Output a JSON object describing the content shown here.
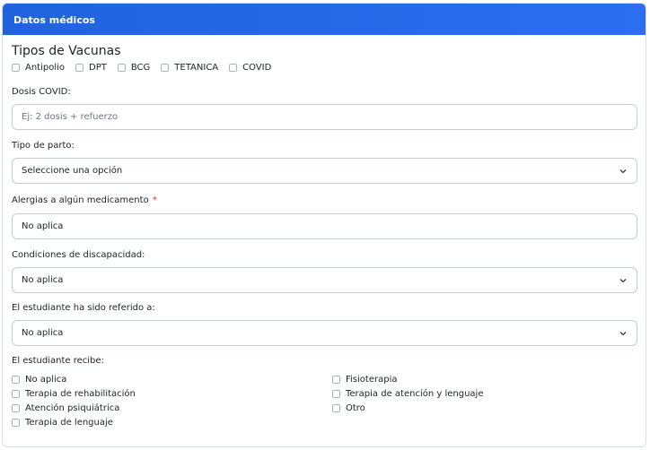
{
  "header": {
    "title": "Datos médicos"
  },
  "vaccines": {
    "title": "Tipos de Vacunas",
    "options": [
      "Antipolio",
      "DPT",
      "BCG",
      "TETANICA",
      "COVID"
    ]
  },
  "covid_doses": {
    "label": "Dosis COVID:",
    "placeholder": "Ej: 2 dosis + refuerzo"
  },
  "birth_type": {
    "label": "Tipo de parto:",
    "value": "Seleccione una opción"
  },
  "allergies": {
    "label": "Alergias a algún medicamento",
    "required_mark": "*",
    "value": "No aplica"
  },
  "disability": {
    "label": "Condiciones de discapacidad:",
    "value": "No aplica"
  },
  "referred": {
    "label": "El estudiante ha sido referido a:",
    "value": "No aplica"
  },
  "receives": {
    "label": "El estudiante recibe:",
    "left": [
      "No aplica",
      "Terapia de rehabilitación",
      "Atención psiquiátrica",
      "Terapia de lenguaje"
    ],
    "right": [
      "Fisioterapia",
      "Terapia de atención y lenguaje",
      "Otro"
    ]
  },
  "colors": {
    "header_bg": "#1f63dd",
    "required": "#dc3545",
    "border": "#c6ccd4"
  }
}
